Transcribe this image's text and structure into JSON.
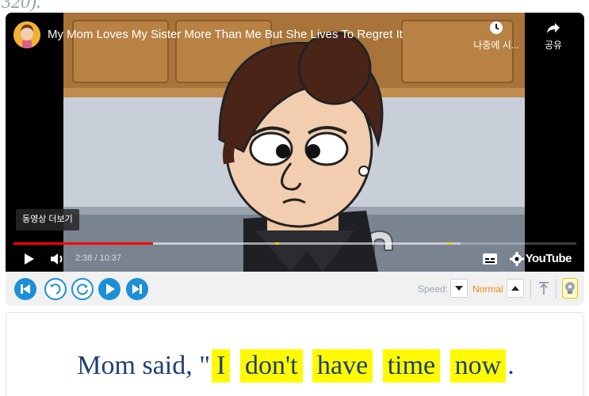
{
  "top_strip": {
    "text": "320)."
  },
  "player": {
    "video_title": "My Mom Loves My Sister More Than Me But She Lives To Regret It",
    "watch_later_label": "나중에 시...",
    "share_label": "공유",
    "more_videos_label": "동영상 더보기",
    "time_display": "2:38 / 10:37",
    "logo_text": "YouTube",
    "progress": {
      "played_fraction": 0.248,
      "buffered_fraction": 0.795,
      "chapter_marks": [
        0.465,
        0.77
      ]
    }
  },
  "toolbar": {
    "speed_label": "Speed:",
    "speed_value": "Normal",
    "accent_color": "#1c8fd8"
  },
  "caption": {
    "prefix": "Mom said, \"",
    "words": [
      "I",
      "don't",
      "have",
      "time",
      "now"
    ],
    "suffix": ".",
    "highlight_color": "#fffa00",
    "text_color": "#1d3f73"
  },
  "icons": [
    "watch-later-icon",
    "share-icon",
    "play-icon",
    "volume-icon",
    "subtitles-icon",
    "settings-icon",
    "skip-start-icon",
    "rewind-icon",
    "replay-icon",
    "play-next-icon",
    "skip-end-icon",
    "speed-down-icon",
    "speed-up-icon",
    "scroll-top-icon",
    "lightbulb-icon"
  ]
}
